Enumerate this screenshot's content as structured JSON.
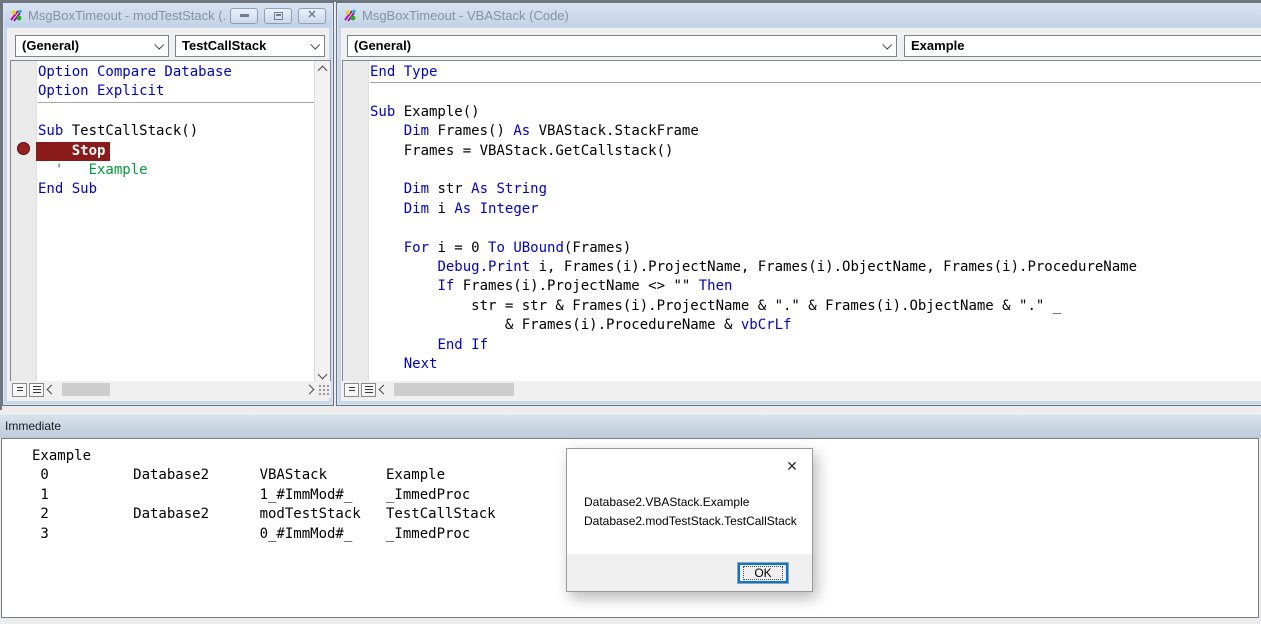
{
  "left_window": {
    "title": "MsgBoxTimeout - modTestStack (...",
    "close_glyph": "✕",
    "combo_general": "(General)",
    "combo_procedure": "TestCallStack",
    "code": [
      {
        "segs": [
          [
            "k",
            "Option Compare Database"
          ]
        ]
      },
      {
        "segs": [
          [
            "k",
            "Option Explicit"
          ]
        ],
        "sep": true
      },
      {
        "segs": [
          [
            "n",
            " "
          ]
        ]
      },
      {
        "segs": [
          [
            "k",
            "Sub "
          ],
          [
            "n",
            "TestCallStack()"
          ]
        ]
      },
      {
        "segs": [
          [
            "bp",
            "    Stop"
          ]
        ]
      },
      {
        "segs": [
          [
            "c",
            "  '   Example"
          ]
        ]
      },
      {
        "segs": [
          [
            "k",
            "End Sub"
          ]
        ]
      }
    ]
  },
  "right_window": {
    "title": "MsgBoxTimeout - VBAStack (Code)",
    "combo_general": "(General)",
    "combo_procedure": "Example",
    "code": [
      {
        "segs": [
          [
            "k",
            "End Type"
          ]
        ],
        "sep": true
      },
      {
        "segs": [
          [
            "n",
            " "
          ]
        ]
      },
      {
        "segs": [
          [
            "k",
            "Sub "
          ],
          [
            "n",
            "Example()"
          ]
        ]
      },
      {
        "segs": [
          [
            "n",
            "    "
          ],
          [
            "k",
            "Dim"
          ],
          [
            "n",
            " Frames() "
          ],
          [
            "k",
            "As"
          ],
          [
            "n",
            " VBAStack.StackFrame"
          ]
        ]
      },
      {
        "segs": [
          [
            "n",
            "    Frames = VBAStack.GetCallstack()"
          ]
        ]
      },
      {
        "segs": [
          [
            "n",
            " "
          ]
        ]
      },
      {
        "segs": [
          [
            "n",
            "    "
          ],
          [
            "k",
            "Dim"
          ],
          [
            "n",
            " str "
          ],
          [
            "k",
            "As"
          ],
          [
            "n",
            " "
          ],
          [
            "k",
            "String"
          ]
        ]
      },
      {
        "segs": [
          [
            "n",
            "    "
          ],
          [
            "k",
            "Dim"
          ],
          [
            "n",
            " i "
          ],
          [
            "k",
            "As"
          ],
          [
            "n",
            " "
          ],
          [
            "k",
            "Integer"
          ]
        ]
      },
      {
        "segs": [
          [
            "n",
            " "
          ]
        ]
      },
      {
        "segs": [
          [
            "n",
            "    "
          ],
          [
            "k",
            "For"
          ],
          [
            "n",
            " i = 0 "
          ],
          [
            "k",
            "To"
          ],
          [
            "n",
            " "
          ],
          [
            "k",
            "UBound"
          ],
          [
            "n",
            "(Frames)"
          ]
        ]
      },
      {
        "segs": [
          [
            "n",
            "        "
          ],
          [
            "k",
            "Debug.Print"
          ],
          [
            "n",
            " i, Frames(i).ProjectName, Frames(i).ObjectName, Frames(i).ProcedureName"
          ]
        ]
      },
      {
        "segs": [
          [
            "n",
            "        "
          ],
          [
            "k",
            "If"
          ],
          [
            "n",
            " Frames(i).ProjectName <> \"\" "
          ],
          [
            "k",
            "Then"
          ]
        ]
      },
      {
        "segs": [
          [
            "n",
            "            str = str & Frames(i).ProjectName & \".\" & Frames(i).ObjectName & \".\" _"
          ]
        ]
      },
      {
        "segs": [
          [
            "n",
            "                & Frames(i).ProcedureName & "
          ],
          [
            "k",
            "vbCrLf"
          ]
        ]
      },
      {
        "segs": [
          [
            "n",
            "        "
          ],
          [
            "k",
            "End If"
          ]
        ]
      },
      {
        "segs": [
          [
            "n",
            "    "
          ],
          [
            "k",
            "Next"
          ]
        ]
      }
    ]
  },
  "immediate": {
    "title": "Immediate",
    "lines": [
      "Example",
      " 0          Database2      VBAStack       Example",
      " 1                         1_#ImmMod#_    _ImmedProc",
      " 2          Database2      modTestStack   TestCallStack",
      " 3                         0_#ImmMod#_    _ImmedProc"
    ]
  },
  "dialog": {
    "close_glyph": "✕",
    "message_lines": [
      "Database2.VBAStack.Example",
      "Database2.modTestStack.TestCallStack"
    ],
    "ok_label": "OK"
  },
  "colors": {
    "keyword_blue": "#0000D4",
    "comment_green": "#009B3C",
    "breakpoint_maroon": "#8B1A1A",
    "focus_blue": "#0078D7"
  }
}
